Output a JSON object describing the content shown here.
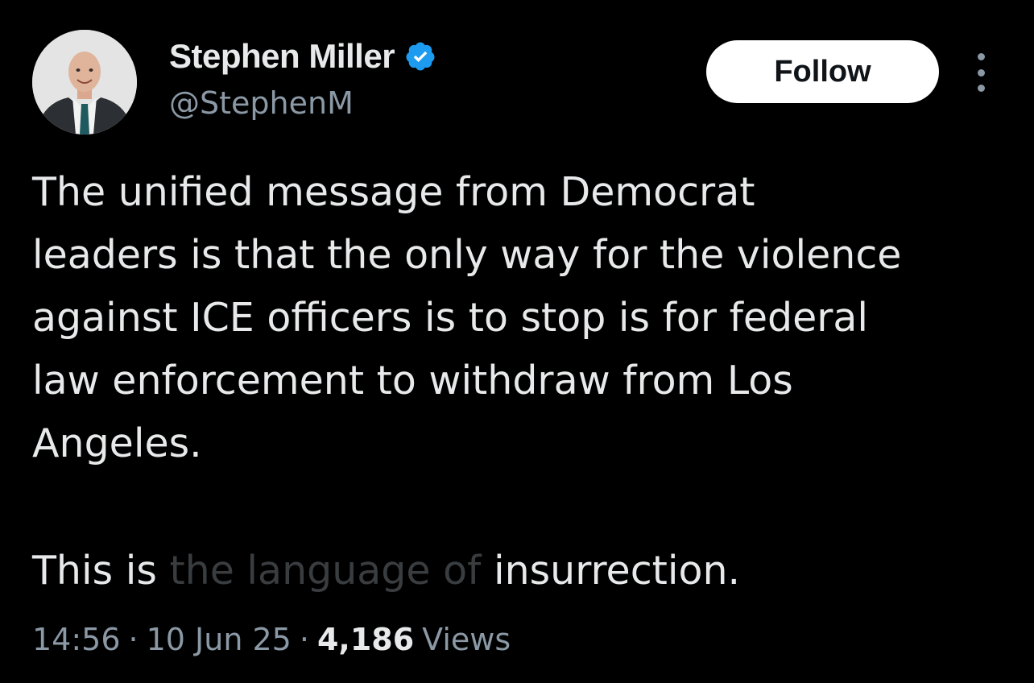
{
  "author": {
    "display_name": "Stephen Miller",
    "handle": "@StephenM",
    "verified": true,
    "verified_icon": "verified-badge-icon",
    "avatar_icon": "avatar"
  },
  "actions": {
    "follow_label": "Follow",
    "more_icon": "more-vertical-icon"
  },
  "tweet": {
    "text": "The unified message from Democrat\nleaders is that the only way for the violence\nagainst ICE officers is to stop is for federal\nlaw enforcement to withdraw from Los\nAngeles.",
    "second_paragraph_start": "This is ",
    "second_paragraph_faded": "the language of",
    "second_paragraph_end": " insurrection."
  },
  "meta": {
    "time": "14:56",
    "separator": "·",
    "date": "10 Jun 25",
    "views_count": "4,186",
    "views_label": "Views"
  },
  "colors": {
    "background": "#000000",
    "text_primary": "#e7e9ea",
    "text_secondary": "#8b98a5",
    "verified_blue": "#1d9bf0",
    "follow_bg": "#ffffff"
  }
}
